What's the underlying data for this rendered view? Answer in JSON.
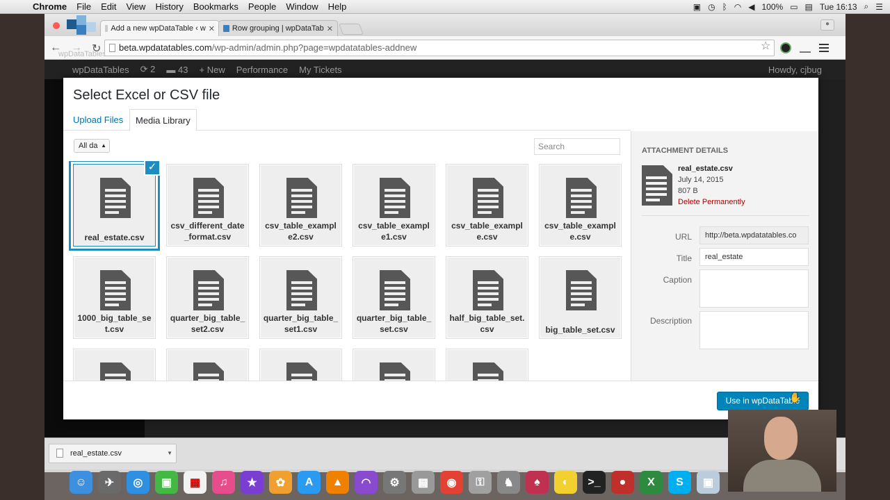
{
  "menubar": {
    "app_name": "Chrome",
    "items": [
      "File",
      "Edit",
      "View",
      "History",
      "Bookmarks",
      "People",
      "Window",
      "Help"
    ],
    "battery": "100%",
    "clock": "Tue 16:13"
  },
  "browser": {
    "tabs": [
      {
        "label": "Add a new wpDataTable ‹ w"
      },
      {
        "label": "Row grouping | wpDataTab"
      }
    ],
    "url_host": "beta.wpdatatables.com",
    "url_path": "/wp-admin/admin.php?page=wpdatatables-addnew",
    "overlay_brand": "wpDataTables"
  },
  "wpbar": {
    "site": "wpDataTables",
    "updates": "2",
    "comments": "43",
    "new": "New",
    "performance": "Performance",
    "tickets": "My Tickets",
    "howdy": "Howdy, cjbug"
  },
  "modal": {
    "title": "Select Excel or CSV file",
    "tabs": {
      "upload": "Upload Files",
      "library": "Media Library"
    },
    "filter": "All da",
    "search_placeholder": "Search",
    "files": [
      "real_estate.csv",
      "csv_different_date_format.csv",
      "csv_table_example2.csv",
      "csv_table_example1.csv",
      "csv_table_example.csv",
      "csv_table_example.csv",
      "1000_big_table_set.csv",
      "quarter_big_table_set2.csv",
      "quarter_big_table_set1.csv",
      "quarter_big_table_set.csv",
      "half_big_table_set.csv",
      "big_table_set.csv"
    ],
    "button": "Use in wpDataTable"
  },
  "details": {
    "heading": "Attachment Details",
    "filename": "real_estate.csv",
    "date": "July 14, 2015",
    "size": "807 B",
    "delete": "Delete Permanently",
    "url_label": "URL",
    "url_value": "http://beta.wpdatatables.co",
    "title_label": "Title",
    "title_value": "real_estate",
    "caption_label": "Caption",
    "description_label": "Description"
  },
  "downloads": {
    "file": "real_estate.csv"
  }
}
